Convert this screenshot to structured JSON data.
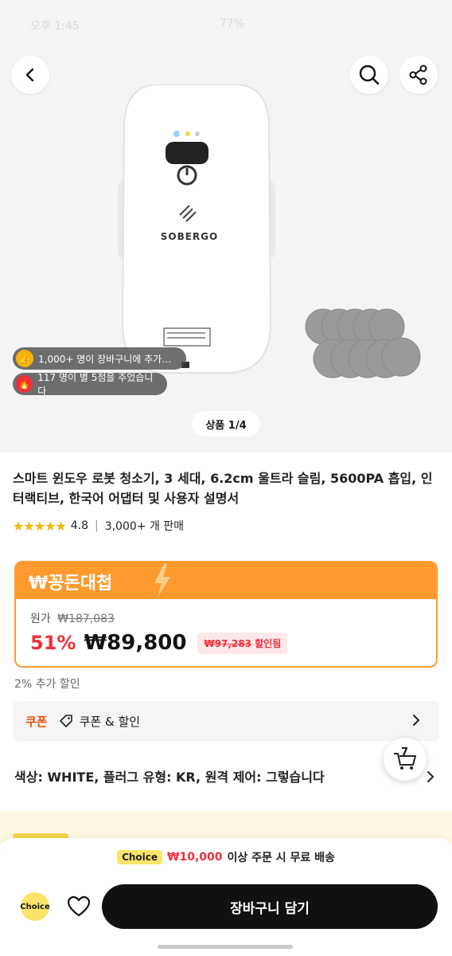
{
  "status_bar": {
    "time": "오후 1:45",
    "battery": "77%"
  },
  "hero": {
    "brand_logo": "SOBERGO",
    "social_proof": [
      {
        "text": "1,000+ 명이 장바구니에 추가…",
        "icon": "thumbs-up-icon",
        "color": "#f5b400"
      },
      {
        "text": "117 명이 별 5점을 주었습니다",
        "icon": "fire-icon",
        "color": "#f0303a"
      }
    ],
    "page_indicator": "상품 1/4"
  },
  "product": {
    "title": "스마트 윈도우 로봇 청소기, 3 세대, 6.2cm 울트라 슬림, 5600PA 흡입, 인터랙티브, 한국어 어댑터 및 사용자 설명서",
    "stars": "★★★★★",
    "rating": "4.8",
    "sold": "3,000+ 개 판매"
  },
  "deal": {
    "header": "₩꽁돈대첩",
    "original_label": "원가",
    "original_price": "₩187,083",
    "discount_pct": "51%",
    "price": "₩89,800",
    "badge_amount": "₩97,283",
    "badge_suffix": "할인됨",
    "extra_discount": "2% 추가 할인"
  },
  "coupon": {
    "tag": "쿠폰",
    "label": "쿠폰 & 할인"
  },
  "options": {
    "summary": "색상: WHITE, 플러그 유형: KR, 원격 제어: 그렇습니다"
  },
  "cart_fab": {
    "count": "7"
  },
  "bottom_bar": {
    "choice_tag": "Choice",
    "ship_amount": "₩10,000",
    "ship_text": "이상 주문 시 무료 배송",
    "choice_logo": "Choice",
    "add_to_cart": "장바구니 담기"
  },
  "colors": {
    "accent_orange": "#ff9a2e",
    "price_red": "#f0303a",
    "choice_yellow": "#fbe46b"
  }
}
